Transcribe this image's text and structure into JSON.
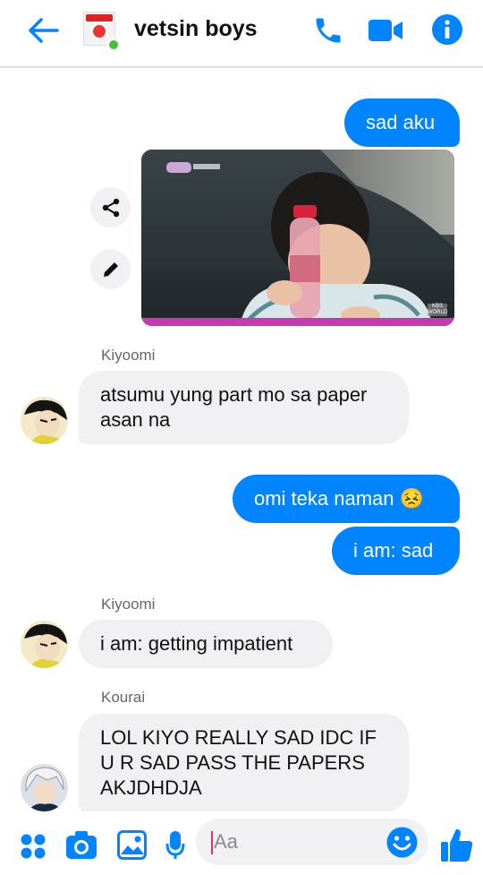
{
  "header": {
    "title": "vetsin boys",
    "thumb_label": "AJI-NO-MOTO"
  },
  "messages": [
    {
      "type": "outgoing",
      "text": "sad aku"
    },
    {
      "type": "outgoing-image",
      "description": "photo"
    },
    {
      "type": "sender",
      "text": "Kiyoomi"
    },
    {
      "type": "incoming",
      "lines": [
        "atsumu yung part mo sa paper",
        "asan na"
      ]
    },
    {
      "type": "outgoing",
      "text": "omi teka naman 😣"
    },
    {
      "type": "outgoing",
      "text": "i am: sad"
    },
    {
      "type": "sender",
      "text": "Kiyoomi"
    },
    {
      "type": "incoming",
      "text": "i am: getting impatient"
    },
    {
      "type": "sender",
      "text": "Kourai"
    },
    {
      "type": "incoming",
      "lines": [
        "LOL KIYO REALLY SAD IDC IF",
        "U R SAD PASS THE PAPERS",
        "AKJDHDJA"
      ]
    }
  ],
  "photo": {
    "badge": "KBS WORLD"
  },
  "composer": {
    "placeholder": "Aa"
  },
  "colors": {
    "accent": "#0084ff",
    "incoming_bubble": "#f0eff1",
    "online": "#44c237"
  }
}
